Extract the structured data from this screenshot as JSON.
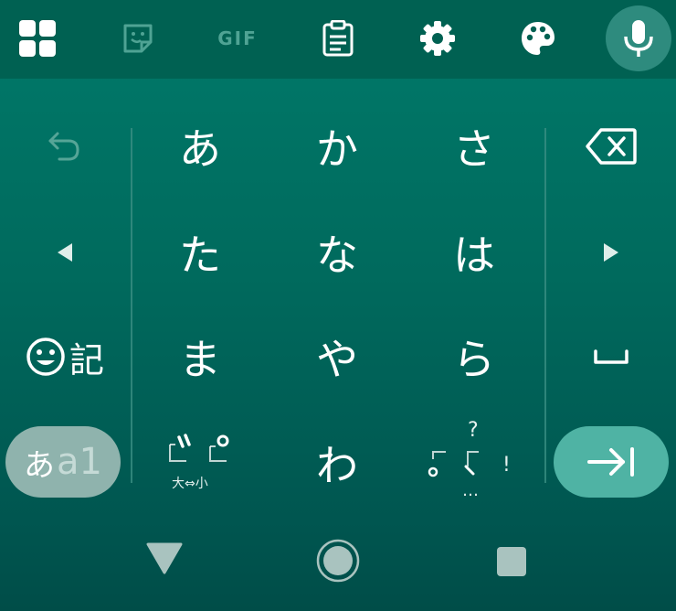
{
  "toolbar": {
    "gif_label": "GIF"
  },
  "keys": {
    "row1": [
      "あ",
      "か",
      "さ"
    ],
    "row2": [
      "た",
      "な",
      "は"
    ],
    "row3": [
      "ま",
      "や",
      "ら"
    ],
    "row4_center": "わ",
    "emoji_kigou": "記",
    "mode_hira": "あ",
    "mode_alnum": "a1",
    "dakuten_size": "大⇔小",
    "punct_question": "?",
    "punct_exclaim": "!",
    "punct_ellipsis": "…"
  },
  "colors": {
    "background_top": "#007a6a",
    "background_bottom": "#004d48",
    "enter_key": "#4fb3a4",
    "mode_key": "#8fb3ad"
  }
}
